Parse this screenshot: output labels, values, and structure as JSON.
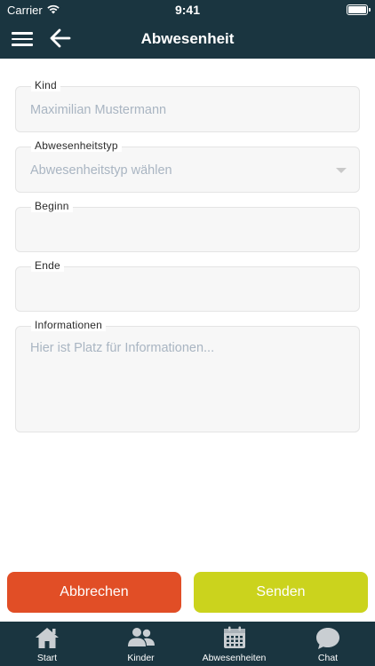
{
  "status_bar": {
    "carrier": "Carrier",
    "time": "9:41"
  },
  "navbar": {
    "title": "Abwesenheit"
  },
  "form": {
    "kind": {
      "label": "Kind",
      "value": "Maximilian  Mustermann"
    },
    "type": {
      "label": "Abwesenheitstyp",
      "placeholder": "Abwesenheitstyp wählen"
    },
    "begin": {
      "label": "Beginn",
      "value": ""
    },
    "end": {
      "label": "Ende",
      "value": ""
    },
    "info": {
      "label": "Informationen",
      "placeholder": "Hier ist Platz für Informationen..."
    }
  },
  "buttons": {
    "cancel": "Abbrechen",
    "send": "Senden",
    "cancel_color": "#e14e26",
    "send_color": "#cbd31d"
  },
  "tabbar": {
    "items": [
      {
        "label": "Start",
        "icon": "home-icon"
      },
      {
        "label": "Kinder",
        "icon": "people-icon"
      },
      {
        "label": "Abwesenheiten",
        "icon": "calendar-icon"
      },
      {
        "label": "Chat",
        "icon": "chat-icon"
      }
    ],
    "background": "#1a3540"
  }
}
